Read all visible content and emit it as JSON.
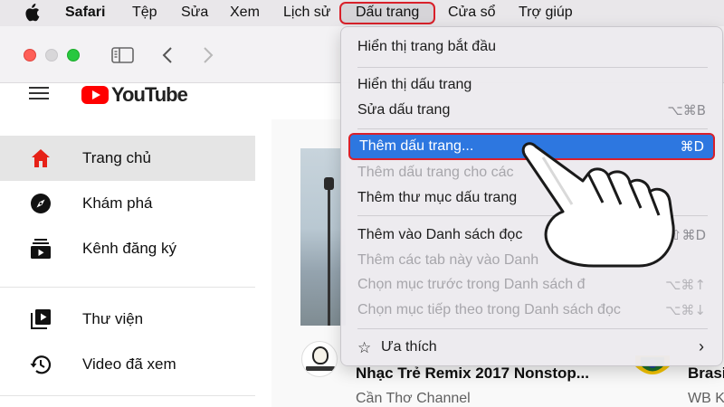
{
  "menubar": {
    "app": "Safari",
    "items": [
      "Tệp",
      "Sửa",
      "Xem",
      "Lịch sử",
      "Dấu trang",
      "Cửa sổ",
      "Trợ giúp"
    ],
    "active": "Dấu trang"
  },
  "dropdown": {
    "items": [
      {
        "label": "Hiển thị trang bắt đầu",
        "shortcut": "",
        "enabled": true
      },
      {
        "label": "Hiển thị dấu trang",
        "shortcut": "",
        "enabled": true
      },
      {
        "label": "Sửa dấu trang",
        "shortcut": "⌥⌘B",
        "enabled": true
      },
      {
        "label": "Thêm dấu trang...",
        "shortcut": "⌘D",
        "enabled": true,
        "highlighted": true
      },
      {
        "label": "Thêm dấu trang cho các",
        "shortcut": "",
        "enabled": false
      },
      {
        "label": "Thêm thư mục dấu trang",
        "shortcut": "",
        "enabled": true
      },
      {
        "label": "Thêm vào Danh sách đọc",
        "shortcut": "⇧⌘D",
        "enabled": true
      },
      {
        "label": "Thêm các tab này vào Danh",
        "shortcut": "",
        "enabled": false
      },
      {
        "label": "Chọn mục trước trong Danh sách đ",
        "shortcut": "⌥⌘↑",
        "enabled": false
      },
      {
        "label": "Chọn mục tiếp theo trong Danh sách đọc",
        "shortcut": "⌥⌘↓",
        "enabled": false
      },
      {
        "label": "Ưa thích",
        "shortcut": "",
        "enabled": true,
        "submenu": true
      }
    ]
  },
  "youtube": {
    "logo": "YouTube",
    "sidebar": [
      "Trang chủ",
      "Khám phá",
      "Kênh đăng ký",
      "Thư viện",
      "Video đã xem"
    ],
    "active_item": "Trang chủ",
    "video": {
      "title": "Nhạc Trẻ Remix 2017 Nonstop...",
      "channel": "Cần Thơ Channel"
    },
    "right_video": {
      "title": "Brasi",
      "channel": "WB K"
    }
  },
  "colors": {
    "highlight": "#2d77e0",
    "annotation": "#d9202a",
    "youtube_red": "#ff0000"
  }
}
